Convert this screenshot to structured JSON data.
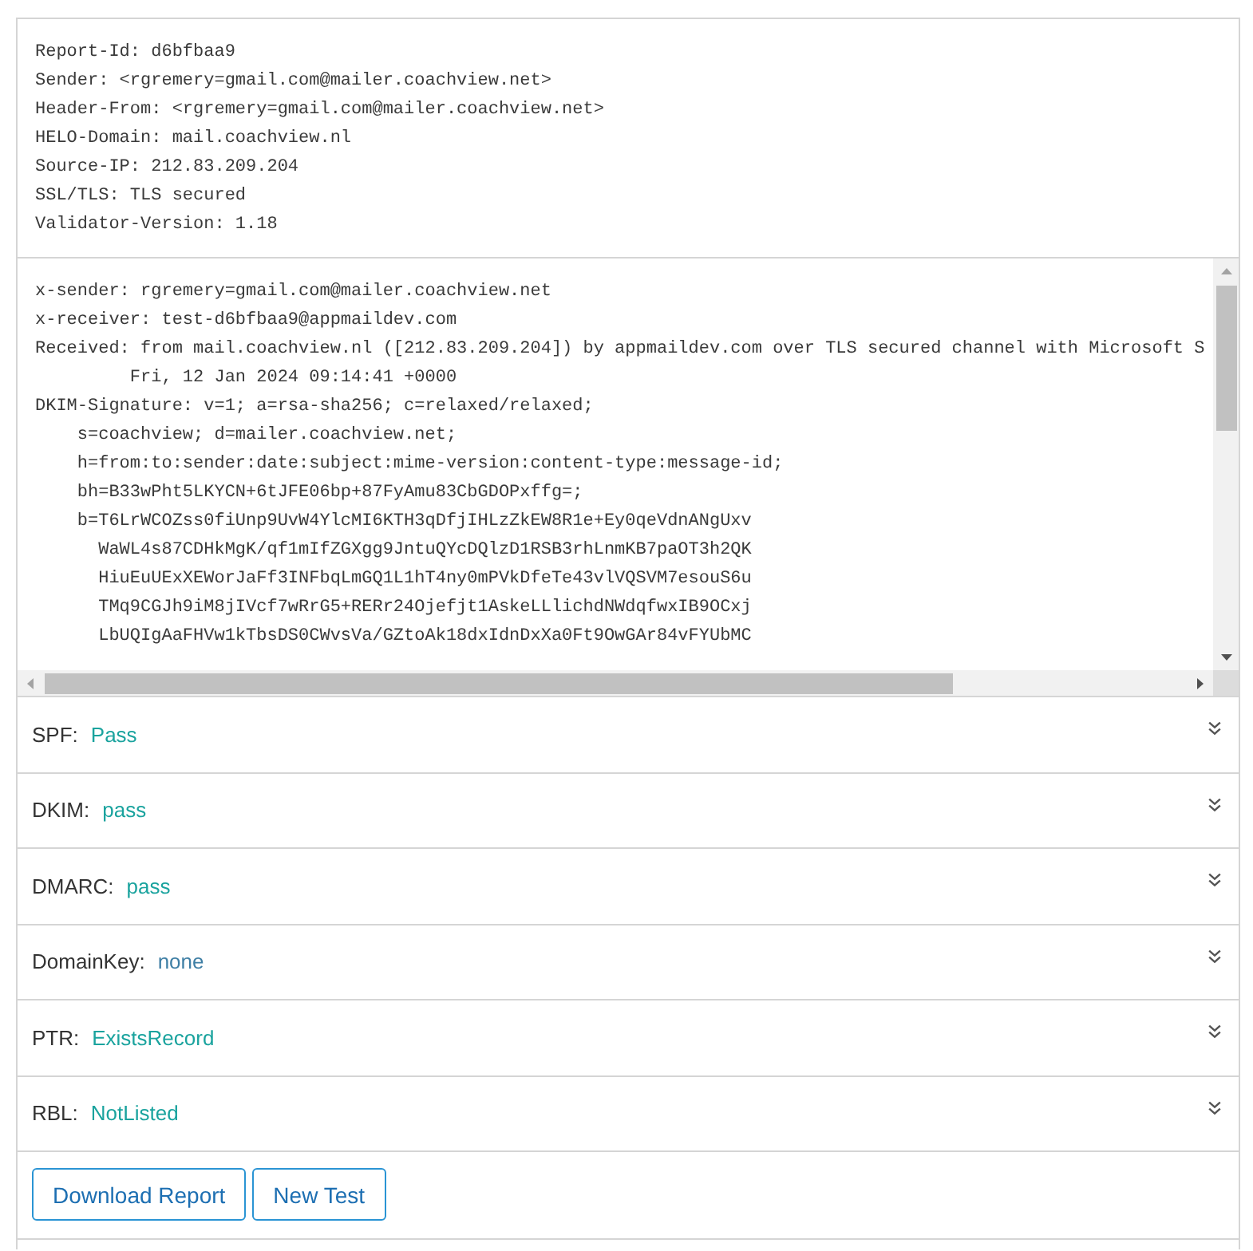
{
  "report_info": {
    "lines": [
      "Report-Id: d6bfbaa9",
      "Sender: <rgremery=gmail.com@mailer.coachview.net>",
      "Header-From: <rgremery=gmail.com@mailer.coachview.net>",
      "HELO-Domain: mail.coachview.nl",
      "Source-IP: 212.83.209.204",
      "SSL/TLS: TLS secured",
      "Validator-Version: 1.18"
    ]
  },
  "headers": {
    "lines": [
      "x-sender: rgremery=gmail.com@mailer.coachview.net",
      "x-receiver: test-d6bfbaa9@appmaildev.com",
      "Received: from mail.coachview.nl ([212.83.209.204]) by appmaildev.com over TLS secured channel with Microsoft S",
      "         Fri, 12 Jan 2024 09:14:41 +0000",
      "DKIM-Signature: v=1; a=rsa-sha256; c=relaxed/relaxed;",
      "    s=coachview; d=mailer.coachview.net;",
      "    h=from:to:sender:date:subject:mime-version:content-type:message-id;",
      "    bh=B33wPht5LKYCN+6tJFE06bp+87FyAmu83CbGDOPxffg=;",
      "    b=T6LrWCOZss0fiUnp9UvW4YlcMI6KTH3qDfjIHLzZkEW8R1e+Ey0qeVdnANgUxv",
      "      WaWL4s87CDHkMgK/qf1mIfZGXgg9JntuQYcDQlzD1RSB3rhLnmKB7paOT3h2QK",
      "      HiuEuUExXEWorJaFf3INFbqLmGQ1L1hT4ny0mPVkDfeTe43vlVQSVM7esouS6u",
      "      TMq9CGJh9iM8jIVcf7wRrG5+RERr24Ojefjt1AskeLLlichdNWdqfwxIB9OCxj",
      "      LbUQIgAaFHVw1kTbsDS0CWvsVa/GZtoAk18dxIdnDxXa0Ft9OwGAr84vFYUbMC"
    ]
  },
  "checks": [
    {
      "label": "SPF:",
      "value": "Pass",
      "color": "#1aa39e"
    },
    {
      "label": "DKIM:",
      "value": "pass",
      "color": "#1aa39e"
    },
    {
      "label": "DMARC:",
      "value": "pass",
      "color": "#1aa39e"
    },
    {
      "label": "DomainKey:",
      "value": "none",
      "color": "#3f7fa5"
    },
    {
      "label": "PTR:",
      "value": "ExistsRecord",
      "color": "#1aa39e"
    },
    {
      "label": "RBL:",
      "value": "NotListed",
      "color": "#1aa39e"
    }
  ],
  "buttons": [
    "Download Report",
    "New Test"
  ]
}
